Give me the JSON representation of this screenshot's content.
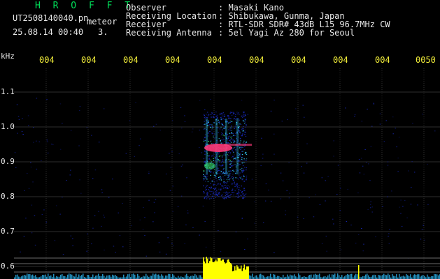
{
  "header": {
    "program": "H R O F F T",
    "filename": "UT2508140040.pn",
    "meteor_label": "meteor",
    "timestamp": "25.08.14 00:40",
    "count": "3.",
    "fields": [
      {
        "label": "Observer",
        "value": ": Masaki Kano"
      },
      {
        "label": "Receiving Location",
        "value": ": Shibukawa, Gunma, Japan"
      },
      {
        "label": "Receiver",
        "value": ": RTL-SDR SDR# 43dB L15 96.7MHz CW"
      },
      {
        "label": "Receiving Antenna",
        "value": ": 5el Yagi Az 280 for Seoul"
      }
    ]
  },
  "axis": {
    "unit": "kHz",
    "time_ticks": [
      "004",
      "004",
      "004",
      "004",
      "004",
      "004",
      "004",
      "004",
      "004",
      "0050"
    ],
    "freq_ticks": [
      "1.1",
      "1.0",
      "0.9",
      "0.8",
      "0.7",
      "0.6"
    ]
  },
  "colors": {
    "background": "#000000",
    "text": "#e8e8e8",
    "title": "#00e05a",
    "tick": "#f2ee3a",
    "grid": "#2e2e2e",
    "noise": "#1a2cc8",
    "echo_core": "#ff3a7a",
    "echo_mid": "#36d2ff",
    "echo_green": "#39e26a",
    "level": "#ffff00",
    "level_low": "#2fc2ff"
  }
}
